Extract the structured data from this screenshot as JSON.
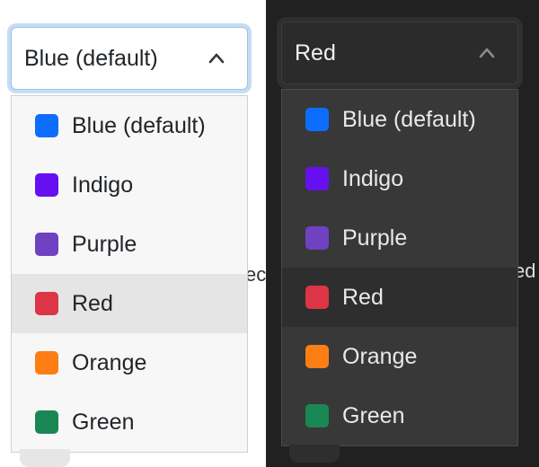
{
  "colors": {
    "light_focus_ring": "#c7dcf4",
    "light_menu_bg": "#f7f7f7",
    "light_active_bg": "#e5e5e5",
    "dark_panel_bg": "#212121",
    "dark_menu_bg": "#383838",
    "dark_active_bg": "#2e2e2e"
  },
  "light": {
    "select_value": "Blue (default)",
    "chevron_icon": "chevron-up-icon",
    "peek_text": "ec",
    "options": [
      {
        "label": "Blue (default)",
        "color": "#0d6efd"
      },
      {
        "label": "Indigo",
        "color": "#6610f2"
      },
      {
        "label": "Purple",
        "color": "#6f42c1"
      },
      {
        "label": "Red",
        "color": "#dc3545",
        "highlighted": true
      },
      {
        "label": "Orange",
        "color": "#fd7e14"
      },
      {
        "label": "Green",
        "color": "#198754"
      }
    ]
  },
  "dark": {
    "select_value": "Red",
    "chevron_icon": "chevron-up-icon",
    "peek_text": "ed",
    "options": [
      {
        "label": "Blue (default)",
        "color": "#0d6efd"
      },
      {
        "label": "Indigo",
        "color": "#6610f2"
      },
      {
        "label": "Purple",
        "color": "#6f42c1"
      },
      {
        "label": "Red",
        "color": "#dc3545",
        "highlighted": true
      },
      {
        "label": "Orange",
        "color": "#fd7e14"
      },
      {
        "label": "Green",
        "color": "#198754"
      }
    ]
  }
}
